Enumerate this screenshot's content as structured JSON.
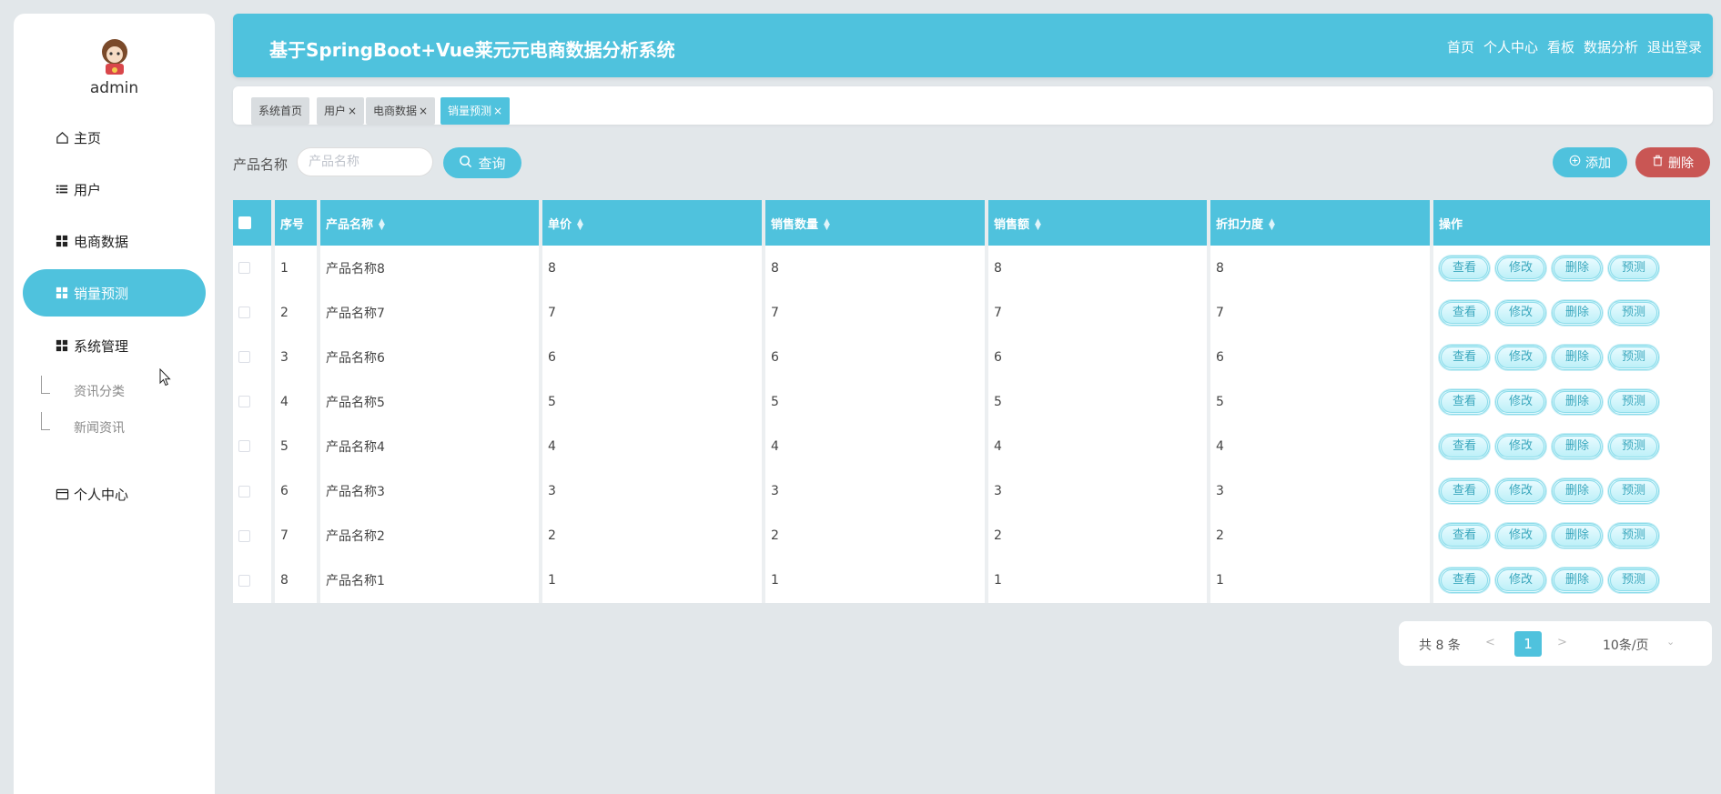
{
  "header": {
    "title": "基于SpringBoot+Vue莱元元电商数据分析系统",
    "nav": [
      "首页",
      "个人中心",
      "看板",
      "数据分析",
      "退出登录"
    ]
  },
  "sidebar": {
    "user": "admin",
    "menu": {
      "home": "主页",
      "users": "用户",
      "ecommerce": "电商数据",
      "forecast": "销量预测",
      "system": "系统管理",
      "sub1": "资讯分类",
      "sub2": "新闻资讯",
      "profile": "个人中心"
    }
  },
  "tabs": {
    "t1": "系统首页",
    "t2": "用户",
    "t3": "电商数据",
    "t4": "销量预测",
    "close": "×"
  },
  "search": {
    "label": "产品名称",
    "placeholder": "产品名称",
    "query_label": "查询",
    "add_label": "添加",
    "delete_label": "删除"
  },
  "table": {
    "headers": {
      "index": "序号",
      "name": "产品名称",
      "price": "单价",
      "qty": "销售数量",
      "amount": "销售额",
      "discount": "折扣力度",
      "ops": "操作"
    },
    "ops": [
      "查看",
      "修改",
      "删除",
      "预测"
    ],
    "rows": [
      {
        "index": "1",
        "name": "产品名称8",
        "price": "8",
        "qty": "8",
        "amount": "8",
        "discount": "8"
      },
      {
        "index": "2",
        "name": "产品名称7",
        "price": "7",
        "qty": "7",
        "amount": "7",
        "discount": "7"
      },
      {
        "index": "3",
        "name": "产品名称6",
        "price": "6",
        "qty": "6",
        "amount": "6",
        "discount": "6"
      },
      {
        "index": "4",
        "name": "产品名称5",
        "price": "5",
        "qty": "5",
        "amount": "5",
        "discount": "5"
      },
      {
        "index": "5",
        "name": "产品名称4",
        "price": "4",
        "qty": "4",
        "amount": "4",
        "discount": "4"
      },
      {
        "index": "6",
        "name": "产品名称3",
        "price": "3",
        "qty": "3",
        "amount": "3",
        "discount": "3"
      },
      {
        "index": "7",
        "name": "产品名称2",
        "price": "2",
        "qty": "2",
        "amount": "2",
        "discount": "2"
      },
      {
        "index": "8",
        "name": "产品名称1",
        "price": "1",
        "qty": "1",
        "amount": "1",
        "discount": "1"
      }
    ]
  },
  "pager": {
    "total": "共 8 条",
    "prev": "<",
    "page": "1",
    "next": ">",
    "size": "10条/页",
    "size_arrow": "⌄"
  },
  "colors": {
    "accent": "#4fc2dd",
    "danger": "#c95654",
    "background": "#e2e7ea"
  },
  "icons": {
    "home": "home-icon",
    "users": "list-icon",
    "grid": "grid-icon",
    "profile": "card-icon",
    "search": "search-icon",
    "add": "plus-circle-icon",
    "delete": "trash-icon"
  }
}
